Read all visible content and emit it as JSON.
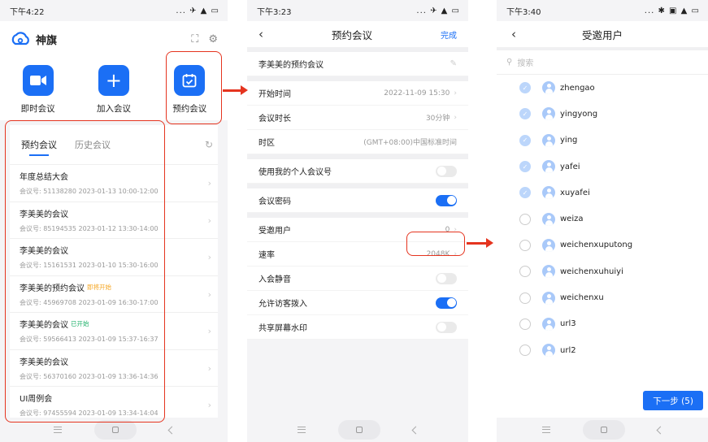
{
  "colors": {
    "accent": "#1b6ff5",
    "annotation": "#e5341f"
  },
  "phone1": {
    "status": {
      "time": "下午4:22",
      "icons": "... ✈ ▲ ▭"
    },
    "brand_title": "神旗",
    "actions": [
      {
        "label": "即时会议",
        "icon": "video-icon"
      },
      {
        "label": "加入会议",
        "icon": "plus-icon"
      },
      {
        "label": "预约会议",
        "icon": "calendar-icon"
      }
    ],
    "tabs": {
      "active": "预约会议",
      "inactive": "历史会议"
    },
    "meetings": [
      {
        "title": "年度总结大会",
        "tag": "",
        "info": "会议号: 51138280  2023-01-13 10:00-12:00"
      },
      {
        "title": "李美美的会议",
        "tag": "",
        "info": "会议号: 85194535  2023-01-12 13:30-14:00"
      },
      {
        "title": "李美美的会议",
        "tag": "",
        "info": "会议号: 15161531  2023-01-10 15:30-16:00"
      },
      {
        "title": "李美美的预约会议",
        "tag": "即将开始",
        "tag_color": "#f5a623",
        "info": "会议号: 45969708  2023-01-09 16:30-17:00"
      },
      {
        "title": "李美美的会议",
        "tag": "已开始",
        "tag_color": "#23b26d",
        "info": "会议号: 59566413  2023-01-09 15:37-16:37"
      },
      {
        "title": "李美美的会议",
        "tag": "",
        "info": "会议号: 56370160  2023-01-09 13:36-14:36"
      },
      {
        "title": "UI周例会",
        "tag": "",
        "info": "会议号: 97455594  2023-01-09 13:34-14:04"
      }
    ]
  },
  "phone2": {
    "status": {
      "time": "下午3:23",
      "icons": "... ✈ ▲ ▭"
    },
    "title": "预约会议",
    "done": "完成",
    "meeting_name": "李美美的预约会议",
    "rows": {
      "start_time": {
        "label": "开始时间",
        "value": "2022-11-09 15:30"
      },
      "duration": {
        "label": "会议时长",
        "value": "30分钟"
      },
      "timezone": {
        "label": "时区",
        "value": "(GMT+08:00)中国标准时间"
      },
      "personal_id": {
        "label": "使用我的个人会议号",
        "on": false
      },
      "password": {
        "label": "会议密码",
        "on": true
      },
      "invitees": {
        "label": "受邀用户",
        "value": "0"
      },
      "rate": {
        "label": "速率",
        "value": "2048K"
      },
      "mute": {
        "label": "入会静音",
        "on": false
      },
      "guest": {
        "label": "允许访客拨入",
        "on": true
      },
      "watermark": {
        "label": "共享屏幕水印",
        "on": false
      }
    }
  },
  "phone3": {
    "status": {
      "time": "下午3:40",
      "icons": "... ✱ ▣ ▲ ▭"
    },
    "title": "受邀用户",
    "search_placeholder": "搜索",
    "users": [
      {
        "name": "zhengao",
        "checked": true
      },
      {
        "name": "yingyong",
        "checked": true
      },
      {
        "name": "ying",
        "checked": true
      },
      {
        "name": "yafei",
        "checked": true
      },
      {
        "name": "xuyafei",
        "checked": true
      },
      {
        "name": "weiza",
        "checked": false
      },
      {
        "name": "weichenxuputong",
        "checked": false
      },
      {
        "name": "weichenxuhuiyi",
        "checked": false
      },
      {
        "name": "weichenxu",
        "checked": false
      },
      {
        "name": "url3",
        "checked": false
      },
      {
        "name": "url2",
        "checked": false
      }
    ],
    "next_button": "下一步 (5)"
  }
}
